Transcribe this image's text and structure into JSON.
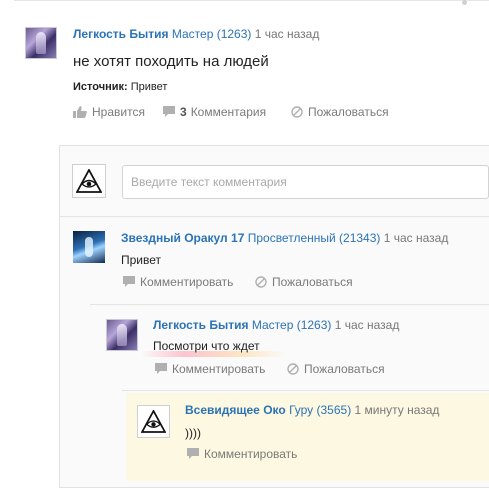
{
  "post": {
    "author": "Легкость Бытия",
    "rank": "Мастер (1263)",
    "time": "1 час назад",
    "body": "не хотят походить на людей",
    "source_label": "Источник:",
    "source_value": " Привет",
    "actions": {
      "like_label": "Нравится",
      "comments_count": "3",
      "comments_label": "Комментария",
      "report_label": "Пожаловаться"
    }
  },
  "comment_form": {
    "placeholder": "Введите текст комментария"
  },
  "comments": [
    {
      "author": "Звездный Оракул 17",
      "rank": "Просветленный (21343)",
      "time": "1 час назад",
      "body": "Привет",
      "reply_label": "Комментировать",
      "report_label": "Пожаловаться"
    },
    {
      "author": "Легкость Бытия",
      "rank": "Мастер (1263)",
      "time": "1 час назад",
      "body": "Посмотри что ждет",
      "reply_label": "Комментировать",
      "report_label": "Пожаловаться"
    },
    {
      "author": "Всевидящее Око",
      "rank": "Гуру (3565)",
      "time": "1 минуту назад",
      "body": "))))",
      "reply_label": "Комментировать"
    }
  ],
  "colors": {
    "link": "#2b73b6",
    "muted": "#7a7a7a",
    "highlight": "#fdf8e1"
  }
}
